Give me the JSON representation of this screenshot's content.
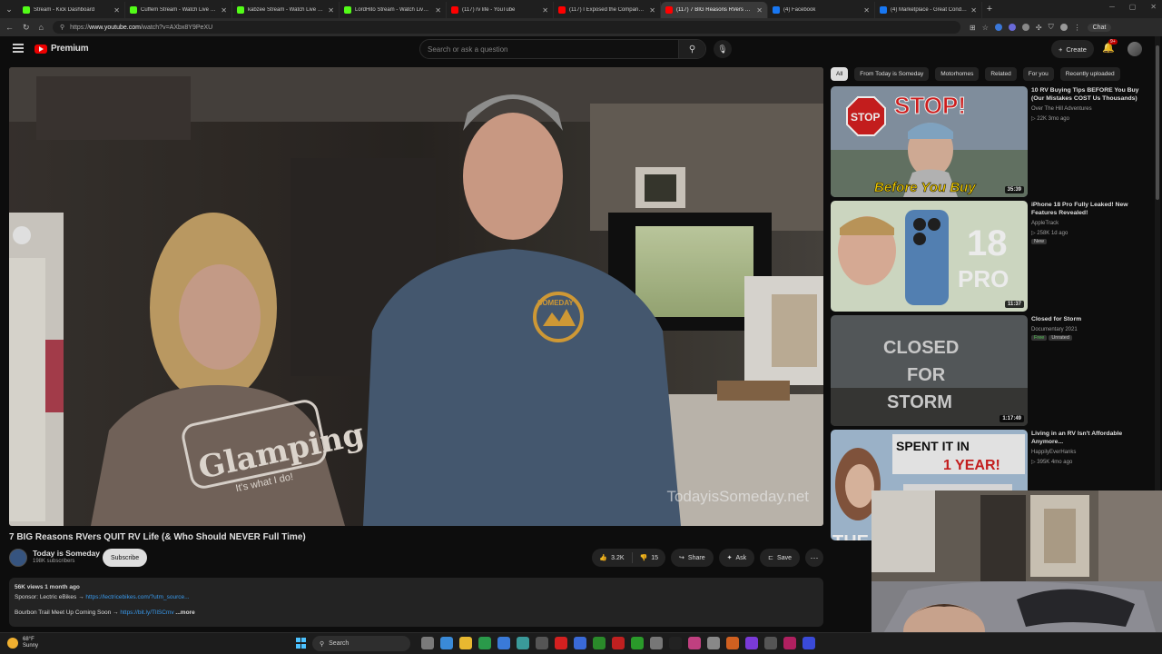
{
  "browser": {
    "tabs": [
      {
        "label": "Stream - Kick Dashboard",
        "icon": "kick-icon",
        "color": "#53fc18",
        "active": false
      },
      {
        "label": "Cuffem Stream - Watch Live on Kick",
        "icon": "kick-icon",
        "color": "#53fc18",
        "active": false
      },
      {
        "label": "kabzee Stream - Watch Live on Kick",
        "icon": "kick-icon",
        "color": "#53fc18",
        "active": false
      },
      {
        "label": "LordHito Stream - Watch Live on Kick",
        "icon": "kick-icon",
        "color": "#53fc18",
        "active": false
      },
      {
        "label": "(117) rv life - YouTube",
        "icon": "youtube-icon",
        "color": "#ff0000",
        "active": false
      },
      {
        "label": "(117) I Exposed the Company Spying",
        "icon": "youtube-icon",
        "color": "#ff0000",
        "active": false
      },
      {
        "label": "(117) 7 BIG Reasons RVers QUIT",
        "icon": "youtube-icon",
        "color": "#ff0000",
        "active": true
      },
      {
        "label": "(4) Facebook",
        "icon": "facebook-icon",
        "color": "#1877f2",
        "active": false
      },
      {
        "label": "(4) Marketplace - Great Condition",
        "icon": "facebook-icon",
        "color": "#1877f2",
        "active": false
      }
    ],
    "url_prefix": "https://",
    "url_host": "www.youtube.com",
    "url_path": "/watch?v=AXbx8Y9PeXU",
    "chat_label": "Chat"
  },
  "header": {
    "logo_text": "Premium",
    "search_placeholder": "Search or ask a question",
    "create_label": "Create",
    "notification_count": "9+"
  },
  "video": {
    "watermark": "TodayisSomeday.net",
    "title": "7 BIG Reasons RVers QUIT RV Life (& Who Should NEVER Full Time)",
    "channel": "Today is Someday",
    "subscribers": "198K subscribers",
    "subscribe_label": "Subscribe",
    "likes": "3.2K",
    "dislikes": "15",
    "share_label": "Share",
    "ask_label": "Ask",
    "save_label": "Save",
    "description": {
      "meta": "56K views  1 month ago",
      "line1_text": "Sponsor: Lectric eBikes → ",
      "line1_link": "https://lectricebikes.com/?utm_source...",
      "line2_text": "Bourbon Trail Meet Up Coming Soon → ",
      "line2_link": "https://bit.ly/TllSCmv",
      "more": "...more"
    }
  },
  "chips": [
    "All",
    "From Today is Someday",
    "Motorhomes",
    "Related",
    "For you",
    "Recently uploaded"
  ],
  "recommendations": [
    {
      "title": "10 RV Buying Tips BEFORE You Buy (Our Mistakes COST Us Thousands)",
      "channel": "Over The Hill Adventures",
      "stats": "▷ 22K  3mo ago",
      "duration": "35:39",
      "tags": []
    },
    {
      "title": "iPhone 18 Pro Fully Leaked! New Features Revealed!",
      "channel": "AppleTrack",
      "stats": "▷ 258K  1d ago",
      "duration": "11:37",
      "tags": [
        "New"
      ]
    },
    {
      "title": "Closed for Storm",
      "channel": "Documentary 2021",
      "stats": "",
      "duration": "1:17:49",
      "tags": [
        "Free",
        "Unrated"
      ]
    },
    {
      "title": "Living in an RV Isn't Affordable Anymore...",
      "channel": "HappilyEverHanks",
      "stats": "▷ 395K  4mo ago",
      "duration": "",
      "tags": []
    }
  ],
  "thumb_text": {
    "stop_sign": "STOP",
    "stop_banner": "STOP!",
    "before_you_buy": "Before You Buy",
    "iphone_18": "18",
    "iphone_pro": "PRO",
    "closed_line1": "CLOSED",
    "closed_line2": "FOR",
    "closed_line3": "STORM",
    "spent_it": "SPENT IT IN",
    "one_year": "1 YEAR!",
    "the": "THE"
  },
  "shirt_text": {
    "glamping": "Glamping",
    "whatido": "It's what I do!",
    "someday": "SOMEDAY"
  },
  "taskbar": {
    "temperature": "68°F",
    "weather": "Sunny",
    "search_label": "Search"
  },
  "colors": {
    "background": "#0f0f0f",
    "youtube_red": "#ff0000",
    "link_blue": "#3ea6ff"
  }
}
